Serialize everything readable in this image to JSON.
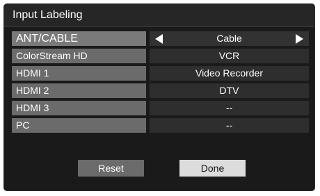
{
  "dialog": {
    "title": "Input Labeling"
  },
  "rows": [
    {
      "label": "ANT/CABLE",
      "value": "Cable",
      "selected": true
    },
    {
      "label": "ColorStream HD",
      "value": "VCR",
      "selected": false
    },
    {
      "label": "HDMI 1",
      "value": "Video Recorder",
      "selected": false
    },
    {
      "label": "HDMI 2",
      "value": "DTV",
      "selected": false
    },
    {
      "label": "HDMI 3",
      "value": "--",
      "selected": false
    },
    {
      "label": "PC",
      "value": "--",
      "selected": false
    }
  ],
  "buttons": {
    "reset_label": "Reset",
    "done_label": "Done"
  },
  "icons": {
    "left": "arrow-left-icon",
    "right": "arrow-right-icon"
  },
  "colors": {
    "dialog_background": "#1a1a1a",
    "label_background": "#6b6b6b",
    "value_background": "#2e2e2e",
    "done_button_background": "#dcdcdc",
    "text": "#ffffff"
  }
}
